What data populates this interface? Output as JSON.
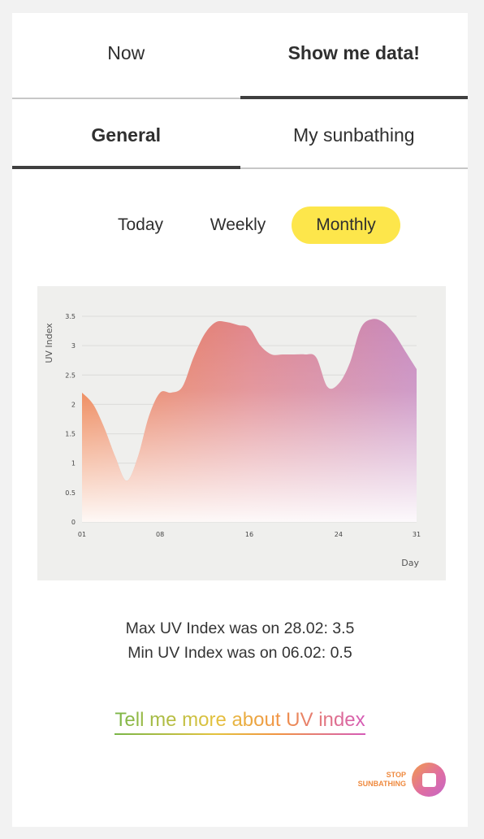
{
  "tabs": {
    "now": "Now",
    "show_data": "Show me data!"
  },
  "subtabs": {
    "general": "General",
    "my_sunbathing": "My sunbathing"
  },
  "period": {
    "today": "Today",
    "weekly": "Weekly",
    "monthly": "Monthly",
    "selected": "Monthly"
  },
  "chart_data": {
    "type": "area",
    "title": "",
    "xlabel": "Day",
    "ylabel": "UV Index",
    "ylim": [
      0,
      3.5
    ],
    "xlim": [
      1,
      31
    ],
    "y_ticks": [
      "0",
      "0.5",
      "1",
      "1.5",
      "2",
      "2.5",
      "3",
      "3.5"
    ],
    "x_ticks": [
      {
        "value": 1,
        "label": "01"
      },
      {
        "value": 8,
        "label": "08"
      },
      {
        "value": 16,
        "label": "16"
      },
      {
        "value": 24,
        "label": "24"
      },
      {
        "value": 31,
        "label": "31"
      }
    ],
    "grid": true,
    "x": [
      1,
      2,
      3,
      4,
      5,
      6,
      7,
      8,
      9,
      10,
      11,
      12,
      13,
      14,
      15,
      16,
      17,
      18,
      19,
      20,
      21,
      22,
      23,
      24,
      25,
      26,
      27,
      28,
      29,
      30,
      31
    ],
    "values": [
      2.2,
      2.0,
      1.6,
      1.1,
      0.7,
      1.1,
      1.8,
      2.2,
      2.2,
      2.3,
      2.8,
      3.2,
      3.4,
      3.4,
      3.35,
      3.3,
      3.0,
      2.85,
      2.85,
      2.85,
      2.85,
      2.8,
      2.3,
      2.35,
      2.7,
      3.3,
      3.45,
      3.4,
      3.2,
      2.9,
      2.6
    ],
    "colors": [
      "#ec7a45",
      "#e0868c",
      "#c78abf"
    ]
  },
  "stats": {
    "max": "Max UV Index was on 28.02: 3.5",
    "min": "Min UV Index was on 06.02: 0.5"
  },
  "more_link": "Tell me more about UV index",
  "stop": {
    "line1": "STOP",
    "line2": "SUNBATHING"
  }
}
